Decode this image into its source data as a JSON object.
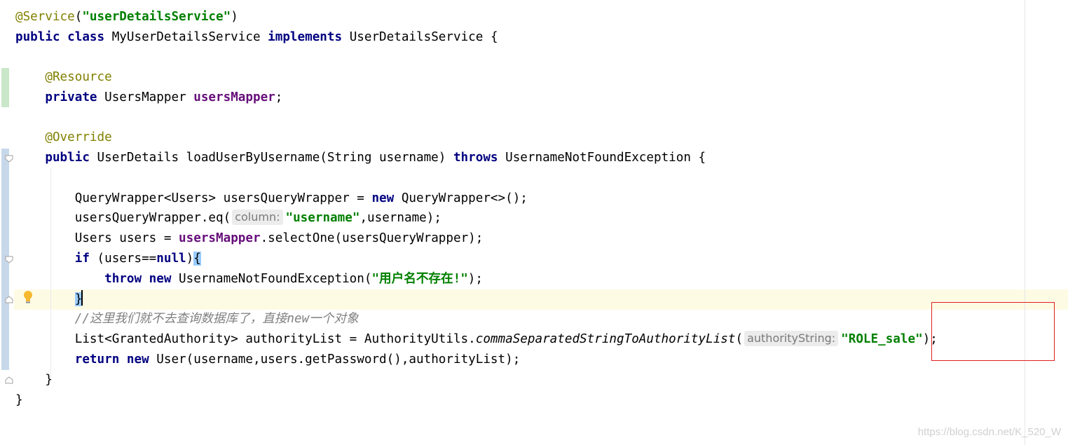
{
  "editor": {
    "lines": {
      "service_annotation": "@Service",
      "service_name": "\"userDetailsService\"",
      "kw_public_class": "public class",
      "class_name": "MyUserDetailsService",
      "kw_implements": "implements",
      "interface_name": "UserDetailsService {",
      "resource_annotation": "@Resource",
      "kw_private": "private",
      "mapper_type": "UsersMapper",
      "mapper_field": "usersMapper",
      "override_annotation": "@Override",
      "kw_public": "public",
      "method_signature": "UserDetails loadUserByUsername(String username)",
      "kw_throws": "throws",
      "exception_type": "UsernameNotFoundException {",
      "wrapper_decl": "QueryWrapper<Users> usersQueryWrapper = ",
      "kw_new": "new",
      "wrapper_ctor": "QueryWrapper<>();",
      "eq_call": "usersQueryWrapper.eq(",
      "hint_column": "column:",
      "str_username": "\"username\"",
      "eq_args": ",username);",
      "users_decl": "Users users = ",
      "select_call": ".selectOne(usersQueryWrapper);",
      "kw_if": "if",
      "if_cond_open": "(users==",
      "kw_null": "null",
      "if_cond_close": ")",
      "open_brace": "{",
      "kw_throw": "throw",
      "throw_ctor": "UsernameNotFoundException(",
      "str_not_found": "\"用户名不存在!\"",
      "throw_end": ");",
      "close_brace": "}",
      "comment": "//这里我们就不去查询数据库了，直接new一个对象",
      "list_decl": "List<GrantedAuthority> authorityList = AuthorityUtils.",
      "static_method": "commaSeparatedStringToAuthorityList",
      "paren_open": "(",
      "hint_authority": "authorityString:",
      "str_role": "\"ROLE_sale\"",
      "list_end": ");",
      "kw_return": "return",
      "return_ctor": "User(username,users.getPassword(),authorityList);",
      "method_close": "}",
      "class_close": "}"
    }
  },
  "watermark": "https://blog.csdn.net/K_520_W",
  "icons": [
    "fold-marker-icon",
    "lightbulb-icon"
  ],
  "colors": {
    "keyword": "#000080",
    "annotation": "#808000",
    "string": "#008000",
    "field": "#660e7a",
    "comment": "#808080",
    "highlight": "#e02020"
  }
}
